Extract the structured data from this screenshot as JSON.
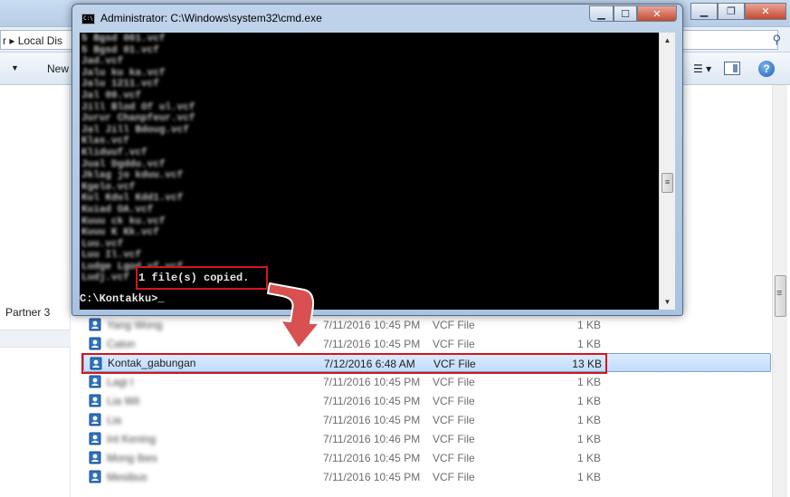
{
  "explorer": {
    "breadcrumb": "r ▸ Local Dis",
    "toolbar": {
      "new_label": "New"
    },
    "nav": {
      "partner_label": "Partner 3"
    },
    "files": [
      {
        "name": "Yang Wong",
        "blurred": true,
        "date": "7/11/2016 10:45 PM",
        "type": "VCF File",
        "size": "1 KB"
      },
      {
        "name": "Calon",
        "blurred": true,
        "date": "7/11/2016 10:45 PM",
        "type": "VCF File",
        "size": "1 KB"
      },
      {
        "name": "Kontak_gabungan",
        "blurred": false,
        "date": "7/12/2016 6:48 AM",
        "type": "VCF File",
        "size": "13 KB",
        "selected": true
      },
      {
        "name": "Lagi I",
        "blurred": true,
        "date": "7/11/2016 10:45 PM",
        "type": "VCF File",
        "size": "1 KB"
      },
      {
        "name": "Lia Wil",
        "blurred": true,
        "date": "7/11/2016 10:45 PM",
        "type": "VCF File",
        "size": "1 KB"
      },
      {
        "name": "Lia",
        "blurred": true,
        "date": "7/11/2016 10:45 PM",
        "type": "VCF File",
        "size": "1 KB"
      },
      {
        "name": "Int Kening",
        "blurred": true,
        "date": "7/11/2016 10:46 PM",
        "type": "VCF File",
        "size": "1 KB"
      },
      {
        "name": "Mong Ibes",
        "blurred": true,
        "date": "7/11/2016 10:45 PM",
        "type": "VCF File",
        "size": "1 KB"
      },
      {
        "name": "Mesibus",
        "blurred": true,
        "date": "7/11/2016 10:45 PM",
        "type": "VCF File",
        "size": "1 KB"
      }
    ]
  },
  "cmd": {
    "title": "Administrator: C:\\Windows\\system32\\cmd.exe",
    "icon_text": "C:\\",
    "blurred_lines": [
      "5 Bgsd 001.vcf",
      "5 Bgsd 01.vcf",
      "Jad.vcf",
      "Jalu ku ka.vcf",
      "Jalu 1211.vcf",
      "Jal 00.vcf",
      "Jill Blod Of ul.vcf",
      "Jurur Chanpfeur.vcf",
      "Jal Jill Bdoug.vcf",
      "Klas.vcf",
      "Kliduuf.vcf",
      "Jual Dgddu.vcf",
      "Jklag jo kduu.vcf",
      "Kgelo.vcf",
      "Kul Kdul Kdd1.vcf",
      "Kuiad OA.vcf",
      "Kuuu ck ku.vcf",
      "Kuuu K Kk.vcf",
      "Luu.vcf",
      "Luu Il.vcf",
      "Ludge Lgod vf.vcf",
      "Ludj.vcf"
    ],
    "copied_message": "1 file(s) copied.",
    "prompt": "C:\\Kontakku>"
  }
}
